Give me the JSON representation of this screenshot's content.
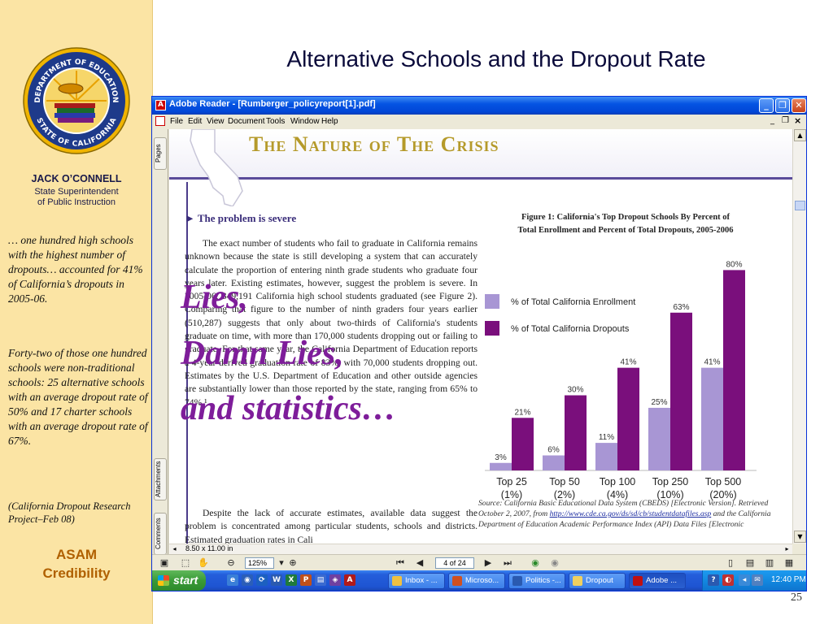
{
  "slide": {
    "title": "Alternative Schools and the Dropout Rate",
    "slide_number": "25",
    "sidebar": {
      "seal_text_top": "DEPARTMENT OF EDUCATION",
      "seal_text_bottom": "STATE OF CALIFORNIA",
      "name": "JACK O’CONNELL",
      "title_line1": "State Superintendent",
      "title_line2": "of Public Instruction",
      "para1": "… one hundred high schools with the highest number of dropouts… accounted for 41% of California’s dropouts in 2005-06.",
      "para2": "Forty-two of those one hundred schools were non-traditional schools: 25 alternative schools with an average dropout rate of 50% and 17 charter schools with an average dropout rate of 67%.",
      "para3": "(California Dropout Research Project–Feb 08)",
      "asam_line1": "ASAM",
      "asam_line2": "Credibility"
    }
  },
  "reader": {
    "window_title": "Adobe Reader - [Rumberger_policyreport[1].pdf]",
    "app_icon": "A",
    "menu": [
      "File",
      "Edit",
      "View",
      "Document",
      "Tools",
      "Window",
      "Help"
    ],
    "nav_tabs": {
      "pages": "Pages",
      "attachments": "Attachments",
      "comments": "Comments"
    },
    "page_size": "8.50 x 11.00 in",
    "zoom": "125%",
    "page_indicator": "4 of 24",
    "icons": {
      "window_min": "minimize-icon",
      "window_max": "maximize-icon",
      "window_close": "close-icon",
      "scroll_up": "▲",
      "scroll_down": "▼"
    }
  },
  "document": {
    "band_title": "The Nature of The Crisis",
    "section_arrow": "►",
    "section_head": "The problem is severe",
    "para1": "The exact number of students who fail to graduate in California remains unknown because the state is still developing a system that can accurately calculate the proportion of entering ninth grade students who graduate four years later. Existing estimates, however, suggest the problem is severe. In 2005-06, 349,191 California high school students graduated (see Figure 2). Comparing that figure to the number of ninth graders four years earlier (510,287) suggests that only about two-thirds of California's students graduate on time, with more than 170,000 students dropping out or failing to graduate. For that same year, the California Department of Education reports a 4-year derived graduation rate of 83%, with 70,000 students dropping out. Estimates by the U.S. Department of Education and other outside agencies are substantially lower than those reported by the state, ranging from 65% to 74%.¹",
    "para2": "Despite the lack of accurate estimates, available data suggest the problem is concentrated among particular students, schools and districts. Estimated graduation rates in Cali",
    "overlay_line1": "Lies,",
    "overlay_line2": "Damn Lies,",
    "overlay_line3": "and statistics…",
    "figure_title1": "Figure 1: California's Top Dropout Schools By Percent of",
    "figure_title2": "Total Enrollment and Percent of Total Dropouts, 2005-2006",
    "source_prefix": "Source: California Basic Educational Data System (CBEDS) [Electronic Version]. Retrieved October 2, 2007, from ",
    "source_url": "http://www.cde.ca.gov/ds/sd/cb/studentdatafiles.asp",
    "source_suffix": " and the California Department of Education Academic Performance Index (API) Data Files [Electronic"
  },
  "chart_data": {
    "type": "bar",
    "categories": [
      "Top 25\n(1%)",
      "Top 50\n(2%)",
      "Top 100\n(4%)",
      "Top 250\n(10%)",
      "Top 500\n(20%)"
    ],
    "series": [
      {
        "name": "% of Total California Enrollment",
        "values": [
          3,
          6,
          11,
          25,
          41
        ],
        "labels": [
          "3%",
          "6%",
          "11%",
          "25%",
          "41%"
        ],
        "color": "#a896d4"
      },
      {
        "name": "% of Total California Dropouts",
        "values": [
          21,
          30,
          41,
          63,
          80
        ],
        "labels": [
          "21%",
          "30%",
          "41%",
          "63%",
          "80%"
        ],
        "color": "#7a0f7c"
      }
    ],
    "ylim": [
      0,
      85
    ],
    "legend_position": "top-left",
    "grid": false
  },
  "taskbar": {
    "start_label": "start",
    "buttons": [
      "Inbox - ...",
      "Microso...",
      "Politics -...",
      "Dropout",
      "Adobe ..."
    ],
    "clock": "12:40 PM"
  },
  "colors": {
    "sidebar_bg": "#fbe4a4",
    "accent_purple": "#7e1d9a",
    "xp_blue": "#0554e3"
  }
}
